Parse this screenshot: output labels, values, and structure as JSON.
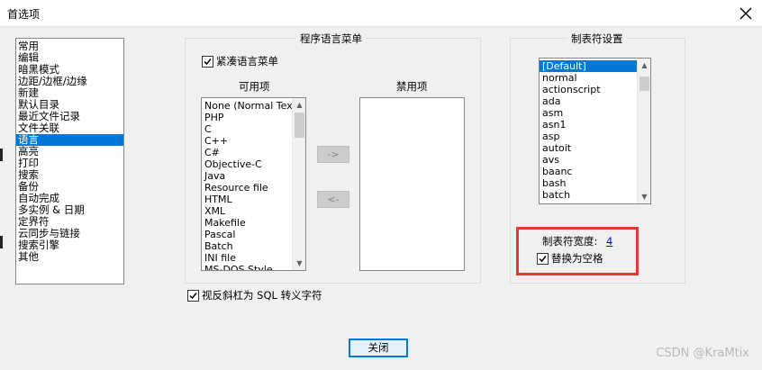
{
  "window": {
    "title": "首选项"
  },
  "categories": {
    "items": [
      "常用",
      "编辑",
      "暗黑模式",
      "边距/边框/边缘",
      "新建",
      "默认目录",
      "最近文件记录",
      "文件关联",
      "语言",
      "高亮",
      "打印",
      "搜索",
      "备份",
      "自动完成",
      "多实例 & 日期",
      "定界符",
      "云同步与链接",
      "搜索引擎",
      "其他"
    ],
    "selected_index": 8
  },
  "language_menu": {
    "group_title": "程序语言菜单",
    "compact_label": "紧凑语言菜单",
    "compact_checked": true,
    "available_title": "可用项",
    "disabled_title": "禁用项",
    "available_items": [
      "None (Normal Text)",
      "PHP",
      "C",
      "C++",
      "C#",
      "Objective-C",
      "Java",
      "Resource file",
      "HTML",
      "XML",
      "Makefile",
      "Pascal",
      "Batch",
      "INI file",
      "MS-DOS Style"
    ],
    "disabled_items": [],
    "move_right_label": "->",
    "move_left_label": "<-"
  },
  "sql_escape": {
    "label": "视反斜杠为 SQL 转义字符",
    "checked": true
  },
  "tab_settings": {
    "group_title": "制表符设置",
    "languages": [
      "[Default]",
      "normal",
      "actionscript",
      "ada",
      "asm",
      "asn1",
      "asp",
      "autoit",
      "avs",
      "baanc",
      "bash",
      "batch"
    ],
    "selected_index": 0,
    "tab_size_label": "制表符宽度:",
    "tab_size_value": "4",
    "replace_label": "替换为空格",
    "replace_checked": true
  },
  "buttons": {
    "close_label": "关闭"
  },
  "watermark": "CSDN @KraMtix",
  "colors": {
    "selection": "#0078d7",
    "highlight_border": "#e53935",
    "link": "#0000ee"
  },
  "icons": {
    "close": "close-icon",
    "check": "check-icon",
    "scroll_up": "scroll-up-arrow-icon",
    "scroll_down": "scroll-down-arrow-icon"
  }
}
